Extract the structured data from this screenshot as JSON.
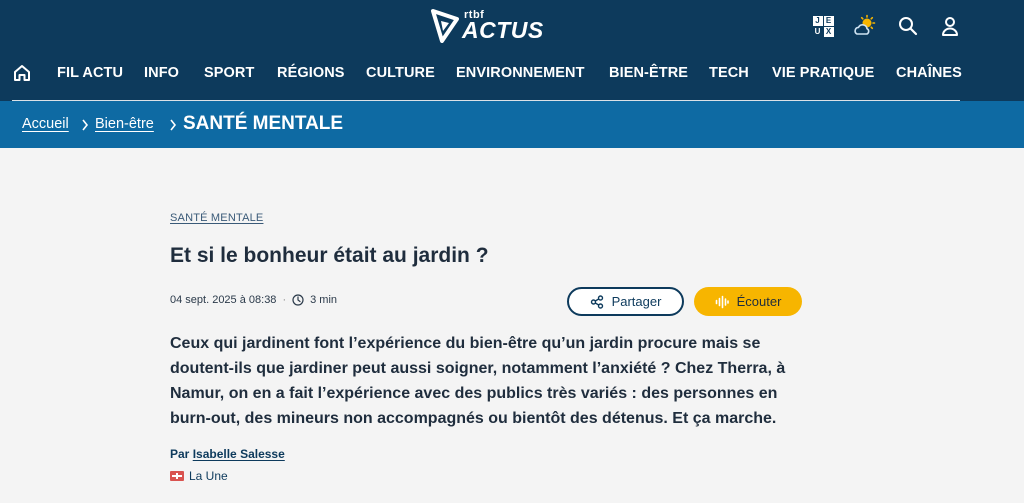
{
  "header": {
    "logo_small": "rtbf",
    "logo_main": "ACTUS",
    "tools": {
      "games_letters": [
        "J",
        "E",
        "U",
        "X"
      ],
      "games_icon": "jeux-icon",
      "weather_icon": "weather-sun-cloud-icon",
      "search_icon": "search-icon",
      "account_icon": "user-icon"
    }
  },
  "nav": {
    "home_icon": "home-icon",
    "items": [
      "FIL ACTU",
      "INFO",
      "SPORT",
      "RÉGIONS",
      "CULTURE",
      "ENVIRONNEMENT",
      "BIEN-ÊTRE",
      "TECH",
      "VIE PRATIQUE",
      "CHAÎNES"
    ]
  },
  "breadcrumb": {
    "items": [
      "Accueil",
      "Bien-être"
    ],
    "current": "SANTÉ MENTALE"
  },
  "article": {
    "category": "SANTÉ MENTALE",
    "title": "Et si le bonheur était au jardin ?",
    "date": "04 sept. 2025 à 08:38",
    "separator": "·",
    "reading_time": "3 min",
    "share_label": "Partager",
    "listen_label": "Écouter",
    "lead_lines": [
      "Ceux qui jardinent font l’expérience du bien-être qu’un jardin procure mais se",
      "doutent-ils que jardiner peut aussi soigner, notamment l’anxiété ? Chez Therra, à",
      "Namur, on en a fait l’expérience avec des publics très variés : des personnes en",
      "burn-out, des mineurs non accompagnés ou bientôt des détenus. Et ça marche."
    ],
    "author_prefix": "Par",
    "author_name": "Isabelle Salesse",
    "source": "La Une"
  },
  "colors": {
    "header_bg": "#0d3a5c",
    "breadcrumb_bg": "#0e6aa3",
    "page_bg": "#f4f4f4",
    "listen_button": "#f7b500",
    "text_dark": "#1f2d3d"
  }
}
